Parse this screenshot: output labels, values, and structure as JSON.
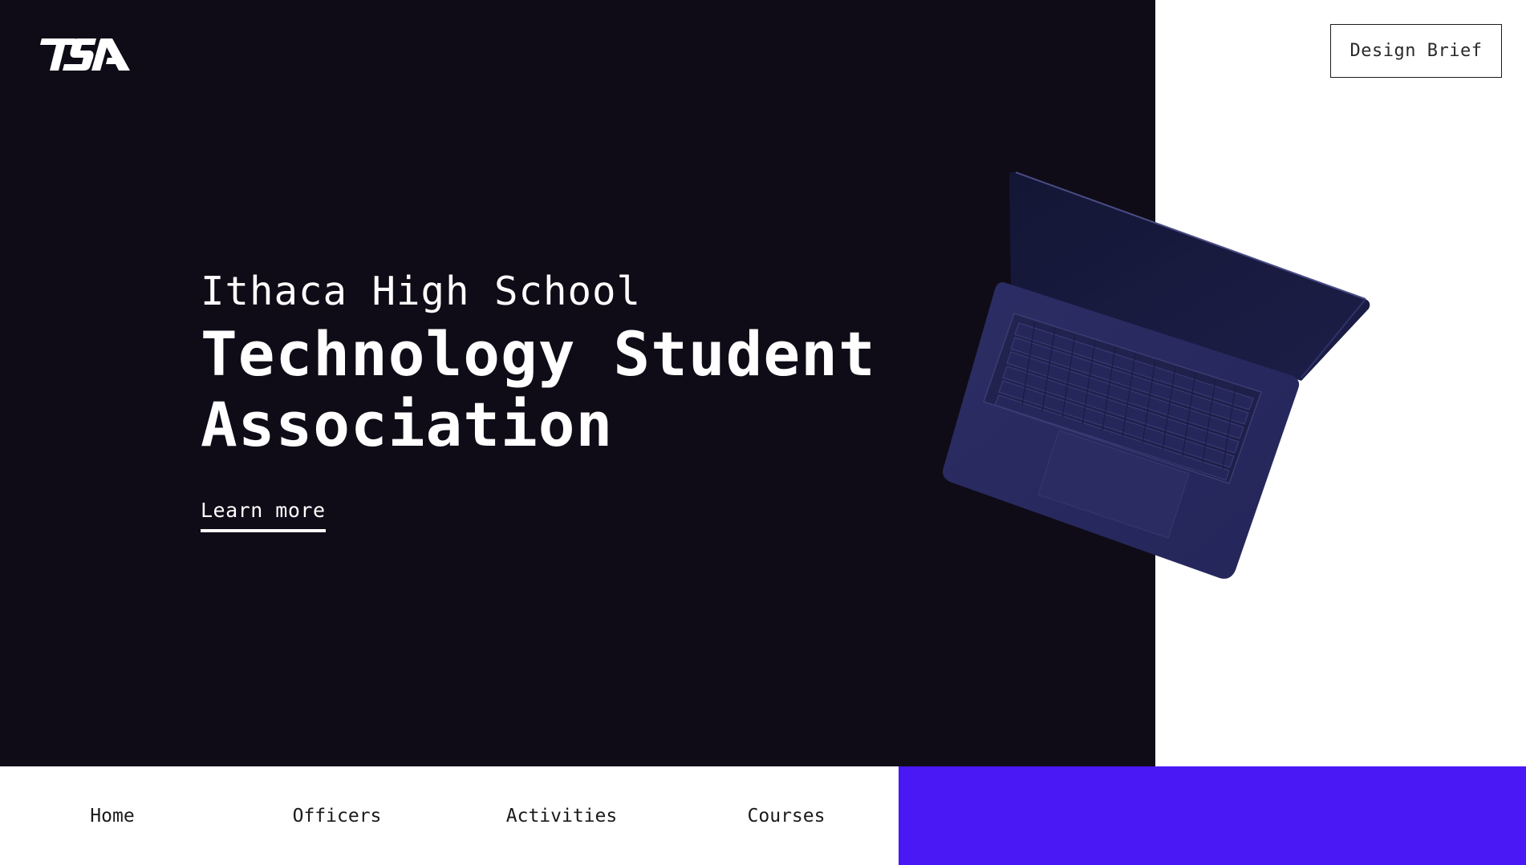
{
  "header": {
    "logo_icon": "tsa-logo-icon",
    "design_brief_label": "Design Brief"
  },
  "hero": {
    "subtitle": "Ithaca High School",
    "title": "Technology Student Association",
    "cta_label": "Learn more",
    "image_icon": "laptop-image"
  },
  "nav": {
    "items": [
      {
        "label": "Home"
      },
      {
        "label": "Officers"
      },
      {
        "label": "Activities"
      },
      {
        "label": "Courses"
      }
    ]
  },
  "colors": {
    "hero_background": "#0f0c17",
    "accent": "#4a17f5",
    "text_light": "#ffffff",
    "text_dark": "#1a1a1a"
  }
}
